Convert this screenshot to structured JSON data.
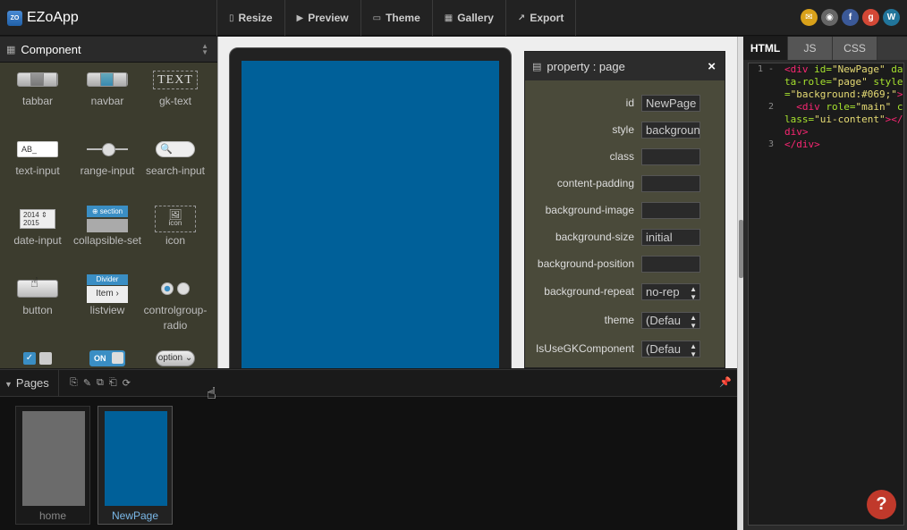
{
  "app": {
    "title": "EZoApp",
    "logo_text": "ZO"
  },
  "menu": [
    {
      "icon": "▯",
      "label": "Resize"
    },
    {
      "icon": "▶",
      "label": "Preview"
    },
    {
      "icon": "▭",
      "label": "Theme"
    },
    {
      "icon": "▦",
      "label": "Gallery"
    },
    {
      "icon": "↗",
      "label": "Export"
    }
  ],
  "socials": [
    {
      "name": "mail",
      "glyph": "✉",
      "color": "#d9a11a"
    },
    {
      "name": "github",
      "glyph": "◉",
      "color": "#666666"
    },
    {
      "name": "facebook",
      "glyph": "f",
      "color": "#3b5998"
    },
    {
      "name": "google-plus",
      "glyph": "g",
      "color": "#d34836"
    },
    {
      "name": "wordpress",
      "glyph": "W",
      "color": "#21759b"
    }
  ],
  "component_panel": {
    "title": "Component",
    "items": [
      {
        "label": "tabbar"
      },
      {
        "label": "navbar"
      },
      {
        "label": "gk-text",
        "icon_text": "TEXT"
      },
      {
        "label": "text-input",
        "icon_text": "AB_"
      },
      {
        "label": "range-input"
      },
      {
        "label": "search-input",
        "icon_text": "🔍"
      },
      {
        "label": "date-input",
        "icon_text": "2014 ⇕ 2015"
      },
      {
        "label": "collapsible-set",
        "icon_text": "⊕ section"
      },
      {
        "label": "icon",
        "icon_text": "icon"
      },
      {
        "label": "button"
      },
      {
        "label": "listview",
        "icon_text": "Divider",
        "icon_text2": "Item ›"
      },
      {
        "label": "controlgroup-radio"
      },
      {
        "label": "",
        "icon_text": "✓"
      },
      {
        "label": "",
        "icon_text": "ON"
      },
      {
        "label": "",
        "icon_text": "option ⌄"
      }
    ]
  },
  "property_window": {
    "title": "property : page",
    "close": "×",
    "fields": [
      {
        "label": "id",
        "value": "NewPage",
        "type": "input"
      },
      {
        "label": "style",
        "value": "background",
        "type": "input"
      },
      {
        "label": "class",
        "value": "",
        "type": "input"
      },
      {
        "label": "content-padding",
        "value": "",
        "type": "input"
      },
      {
        "label": "background-image",
        "value": "",
        "type": "input"
      },
      {
        "label": "background-size",
        "value": "initial",
        "type": "input"
      },
      {
        "label": "background-position",
        "value": "",
        "type": "input"
      },
      {
        "label": "background-repeat",
        "value": "no-rep",
        "type": "select"
      },
      {
        "label": "theme",
        "value": "(Defau",
        "type": "select"
      },
      {
        "label": "IsUseGKComponent",
        "value": "(Defau",
        "type": "select"
      }
    ]
  },
  "code_panel": {
    "tabs": [
      {
        "label": "HTML"
      },
      {
        "label": "JS"
      },
      {
        "label": "CSS"
      }
    ],
    "active_tab": "HTML",
    "lines": [
      {
        "num": "1 -",
        "html": "<span class=\"tag\">&lt;div</span> <span class=\"attr\">id=</span><span class=\"str\">\"NewPage\"</span> <span class=\"attr\">data-role=</span><span class=\"str\">\"page\"</span> <span class=\"attr\">style=</span><span class=\"str\">\"background:#069;\"</span><span class=\"tag\">&gt;</span>"
      },
      {
        "num": "2",
        "html": "  <span class=\"tag\">&lt;div</span> <span class=\"attr\">role=</span><span class=\"str\">\"main\"</span> <span class=\"attr\">class=</span><span class=\"str\">\"ui-content\"</span><span class=\"tag\">&gt;&lt;/div&gt;</span>"
      },
      {
        "num": "3",
        "html": "<span class=\"tag\">&lt;/div&gt;</span>"
      }
    ],
    "help": "?"
  },
  "pages_panel": {
    "title": "Pages",
    "tools": [
      "⎘",
      "✎",
      "⧉",
      "⎗",
      "⟳"
    ],
    "pin": "📌",
    "pages": [
      {
        "label": "home",
        "color": "#6b6b6b",
        "selected": false
      },
      {
        "label": "NewPage",
        "color": "#006099",
        "selected": true
      }
    ]
  },
  "canvas": {
    "page_color": "#006099"
  }
}
